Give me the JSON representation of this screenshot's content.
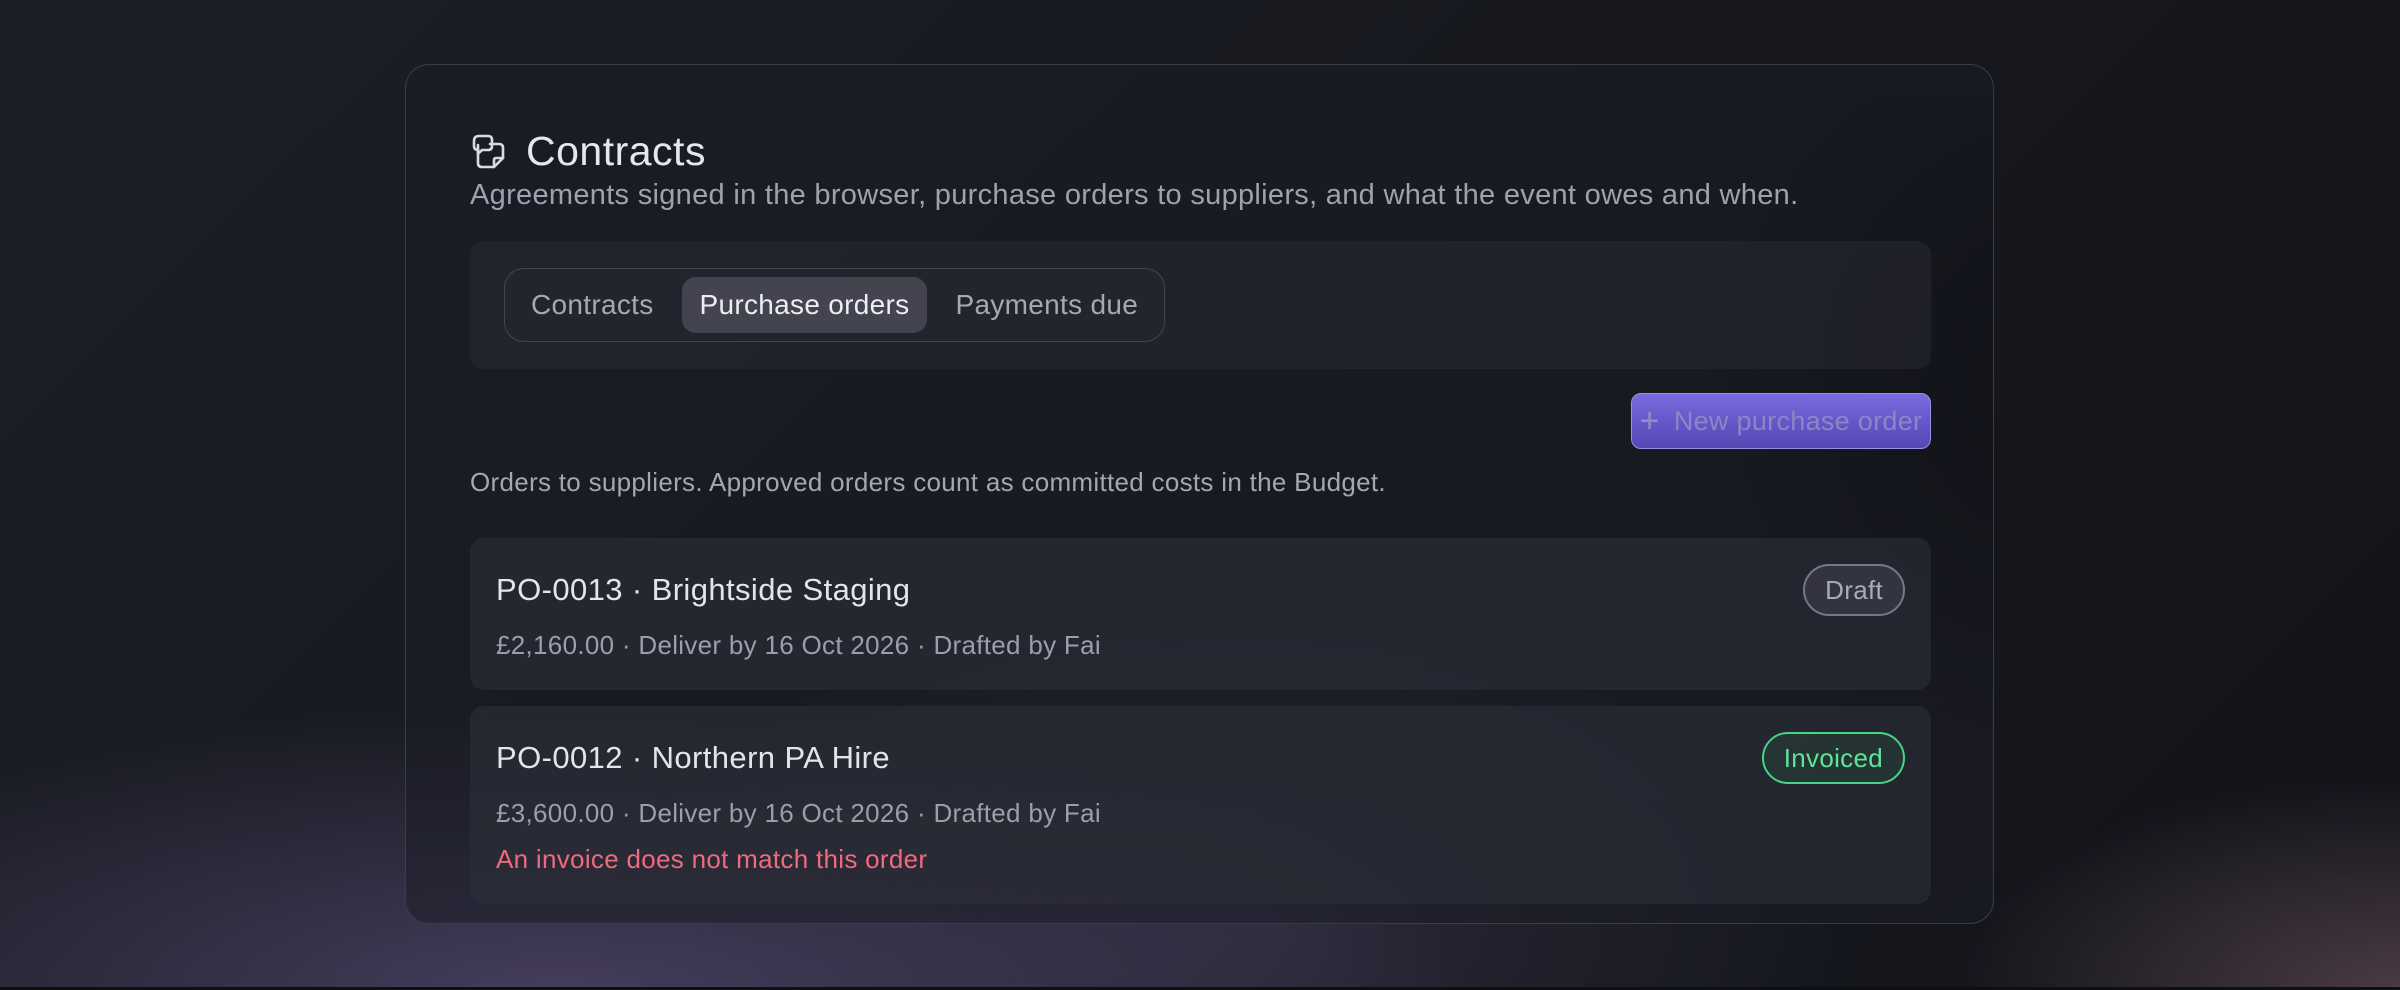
{
  "page": {
    "title": "Contracts",
    "title_icon": "contracts-icon",
    "subtitle": "Agreements signed in the browser, purchase orders to suppliers, and what the event owes and when."
  },
  "tabs": [
    {
      "label": "Contracts",
      "active": false
    },
    {
      "label": "Purchase orders",
      "active": true
    },
    {
      "label": "Payments due",
      "active": false
    }
  ],
  "purchase_orders": {
    "description": "Orders to suppliers. Approved orders count as committed costs in the Budget.",
    "new_button_label": "New purchase order",
    "new_button_icon": "plus-icon",
    "items": [
      {
        "title": "PO-0013 · Brightside Staging",
        "meta": "£2,160.00 · Deliver by 16 Oct 2026 · Drafted by Fai",
        "status": "Draft",
        "warning": ""
      },
      {
        "title": "PO-0012 · Northern PA Hire",
        "meta": "£3,600.00 · Deliver by 16 Oct 2026 · Drafted by Fai",
        "status": "Invoiced",
        "warning": "An invoice does not match this order"
      }
    ]
  },
  "colors": {
    "accent": "#6f61d6",
    "invoiced": "#46d486",
    "warning": "#f06a7b",
    "draft": "#75778a"
  }
}
